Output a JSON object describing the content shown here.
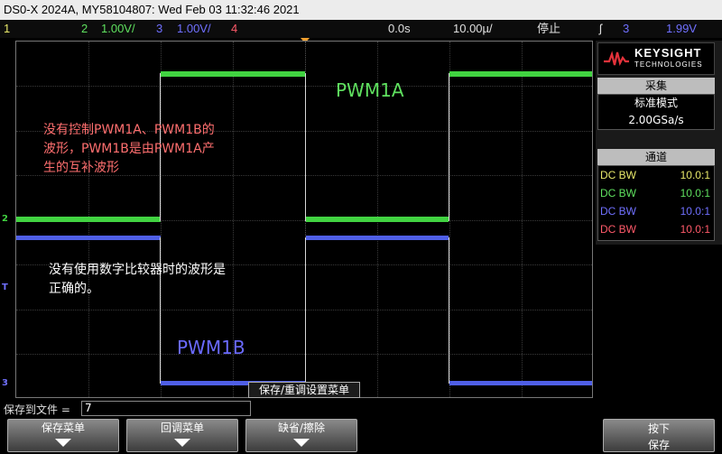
{
  "title_bar": "DS0-X 2024A, MY58104807: Wed Feb 03 11:32:46 2021",
  "status_bar": {
    "ch1": "1",
    "ch2": "2",
    "ch2_scale": "1.00V/",
    "ch3": "3",
    "ch3_scale": "1.00V/",
    "ch4": "4",
    "time_delay": "0.0s",
    "time_scale": "10.00µ/",
    "run_state": "停止",
    "trigger_symbol": "ʃ",
    "trigger_source": "3",
    "trigger_level": "1.99V"
  },
  "screen": {
    "annotation_top": "没有控制PWM1A、PWM1B的\n波形，PWM1B是由PWM1A产\n生的互补波形",
    "annotation_mid": "没有使用数字比较器时的波形是\n正确的。",
    "label_pwm1a": "PWM1A",
    "label_pwm1b": "PWM1B",
    "ch2_marker": "2",
    "ch3_marker": "3",
    "trigger_marker": "T",
    "save_menu_tip": "保存/重调设置菜单"
  },
  "side_panel": {
    "logo_text": "KEYSIGHT",
    "logo_sub": "TECHNOLOGIES",
    "acq_header": "采集",
    "acq_mode": "标准模式",
    "acq_rate": "2.00GSa/s",
    "ch_header": "通道",
    "channels": [
      {
        "coupling": "DC BW",
        "probe": "10.0:1",
        "color": "#e8e86a"
      },
      {
        "coupling": "DC BW",
        "probe": "10.0:1",
        "color": "#5fe05f"
      },
      {
        "coupling": "DC BW",
        "probe": "10.0:1",
        "color": "#7070ff"
      },
      {
        "coupling": "DC BW",
        "probe": "10.0:1",
        "color": "#ff5a6a"
      }
    ]
  },
  "file_row": {
    "label": "保存到文件 =",
    "value": "7"
  },
  "softkeys": {
    "save_menu": "保存菜单",
    "recall_menu": "回调菜单",
    "default_erase": "缺省/擦除",
    "press_line1": "按下",
    "press_line2": "保存"
  },
  "colors": {
    "pwm1a_trace": "#41d341",
    "pwm1b_trace": "#4f5fe6",
    "annotation_red": "#ff6f6f",
    "trigger_marker": "#f0a030"
  }
}
